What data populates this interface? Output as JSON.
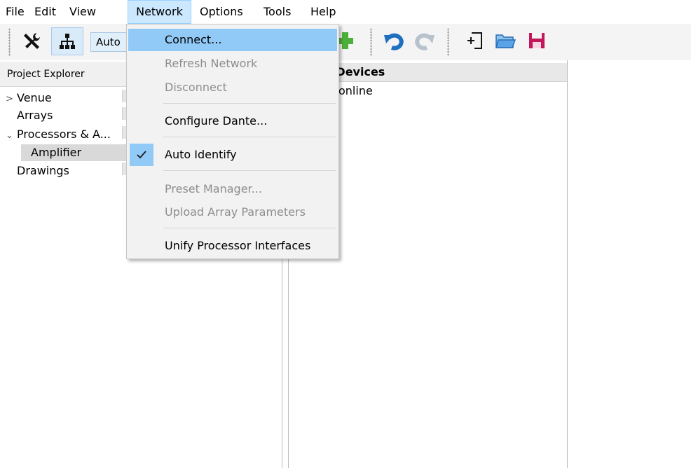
{
  "menubar": {
    "items": [
      {
        "label": "File"
      },
      {
        "label": "Edit"
      },
      {
        "label": "View"
      },
      {
        "label": "Network"
      },
      {
        "label": "Options"
      },
      {
        "label": "Tools"
      },
      {
        "label": "Help"
      }
    ]
  },
  "toolbar": {
    "auto_combo_value": "Auto",
    "icons": [
      "tools-icon",
      "network-tree-icon",
      "add-plus-icon",
      "undo-icon",
      "redo-icon",
      "new-file-icon",
      "open-folder-icon",
      "save-disk-icon"
    ]
  },
  "explorer": {
    "header": "Project Explorer",
    "items": [
      {
        "label": "Venue",
        "arrow": ">"
      },
      {
        "label": "Arrays",
        "arrow": ""
      },
      {
        "label": "Processors & A...",
        "arrow": "⌄"
      },
      {
        "label": "Amplifier",
        "arrow": ""
      },
      {
        "label": "Drawings",
        "arrow": ""
      }
    ]
  },
  "devices": {
    "header": "e Devices",
    "status": "online"
  },
  "network_menu": {
    "items": [
      {
        "label": "Connect..."
      },
      {
        "label": "Refresh Network"
      },
      {
        "label": "Disconnect"
      },
      {
        "label": "Configure Dante..."
      },
      {
        "label": "Auto Identify"
      },
      {
        "label": "Preset Manager..."
      },
      {
        "label": "Upload Array Parameters"
      },
      {
        "label": "Unify Processor Interfaces"
      }
    ]
  },
  "colors": {
    "menu_hover": "#91c9f7",
    "menubar_active": "#cce8ff",
    "disabled_text": "#8d8d8d",
    "add_green": "#4caf3a",
    "undo_blue": "#1f6fc1",
    "save_red": "#c2185b"
  }
}
